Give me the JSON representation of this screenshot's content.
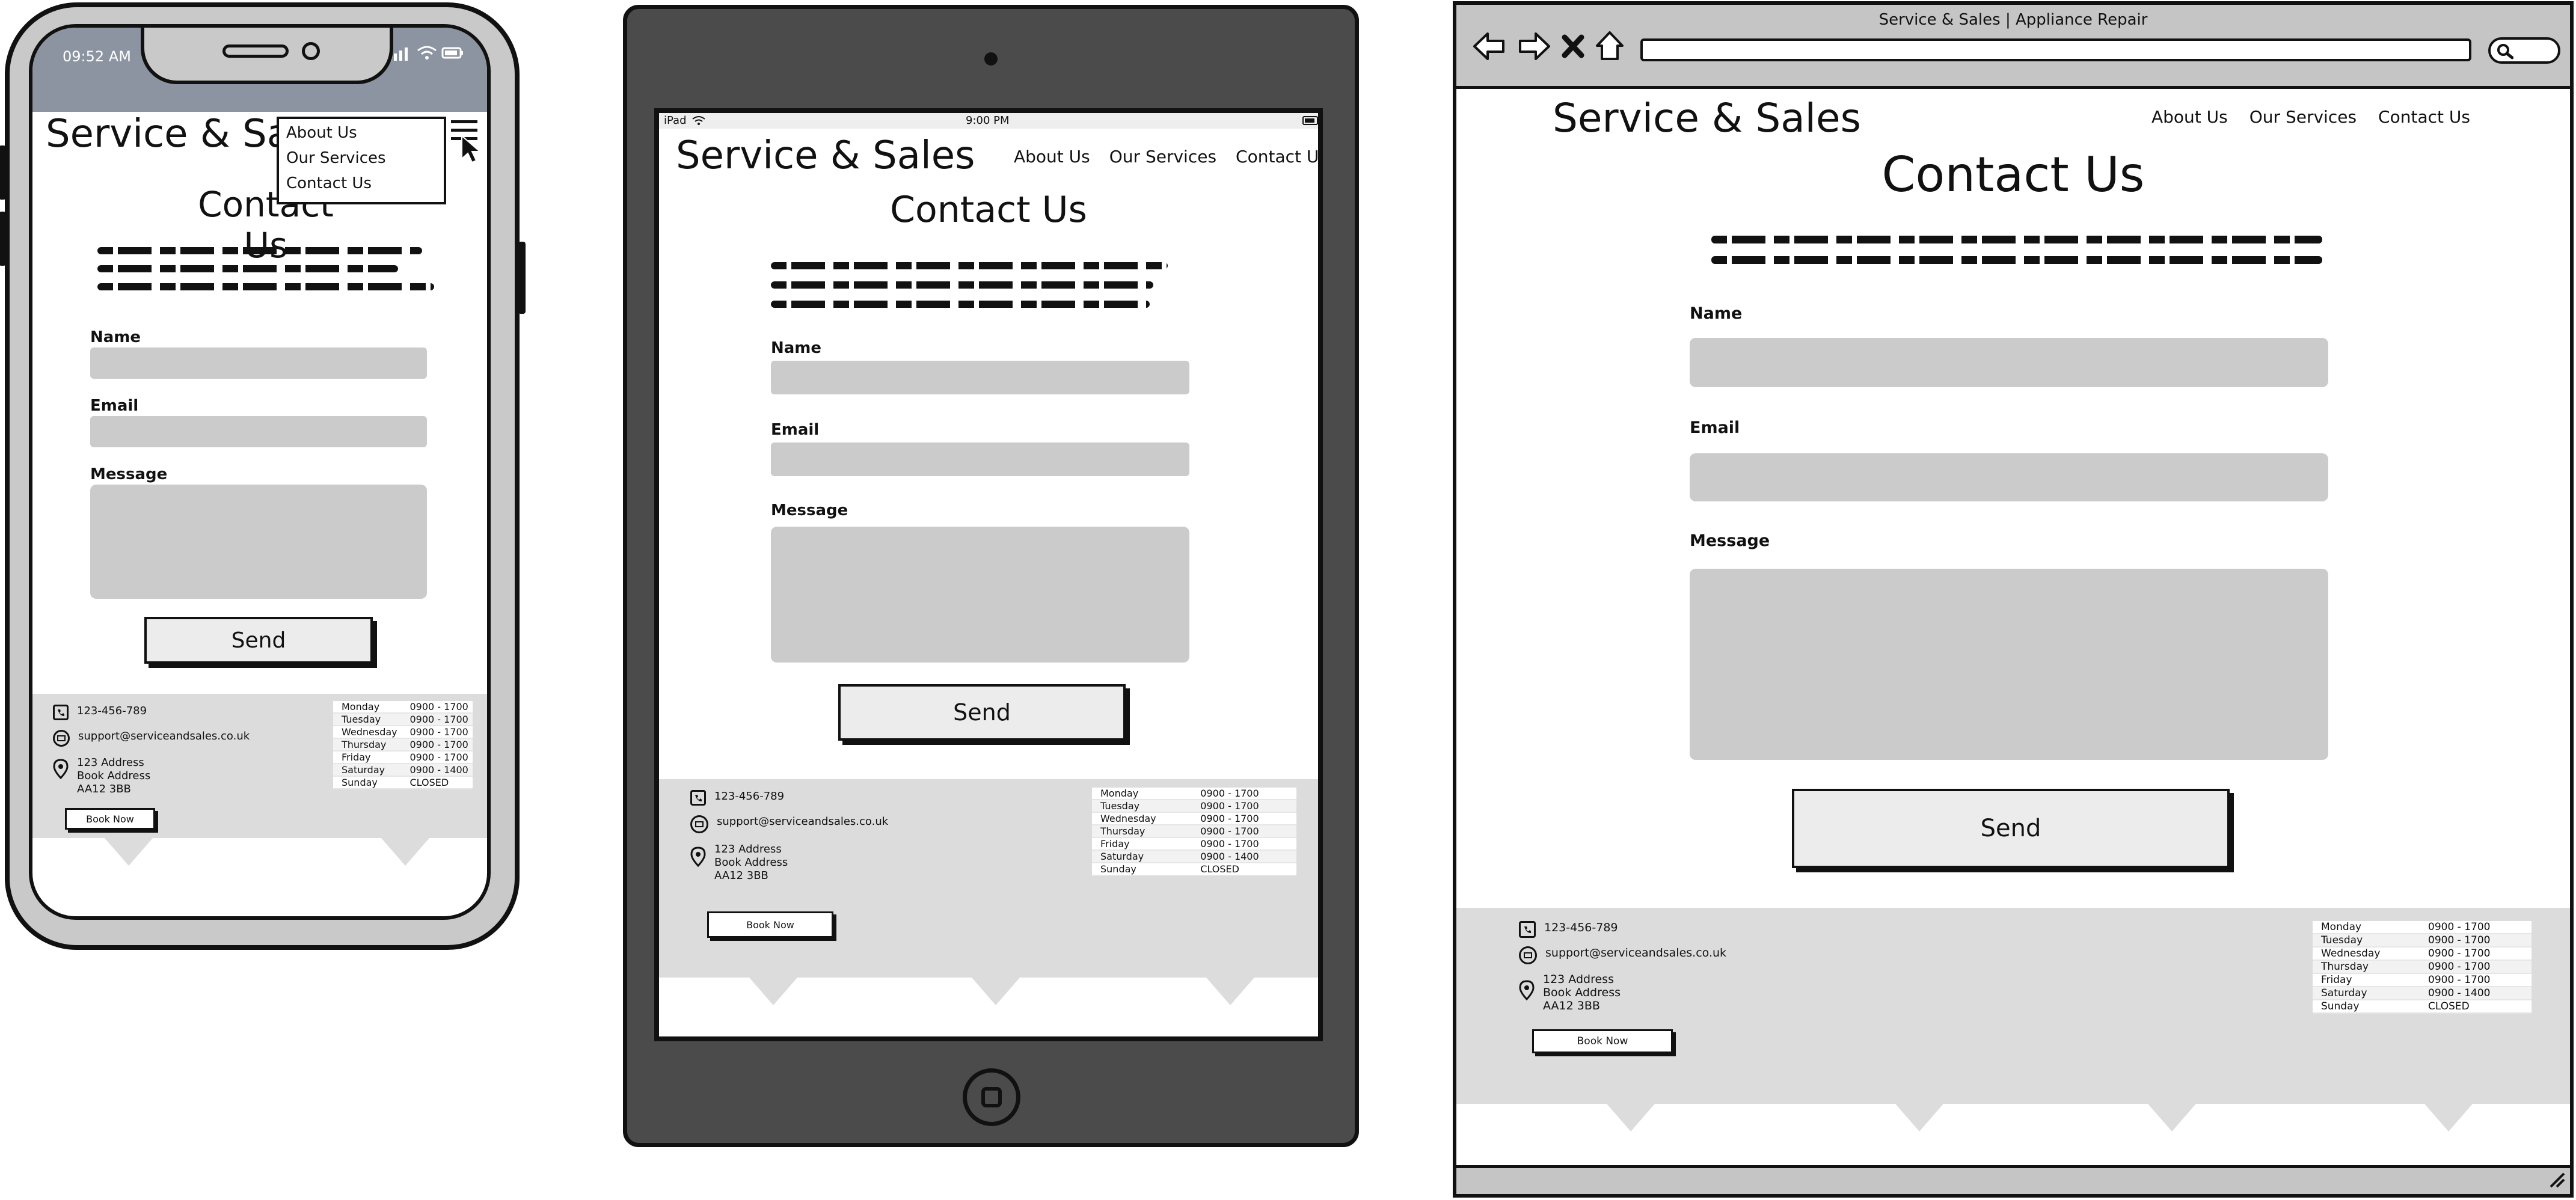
{
  "brand": "Service & Sales",
  "nav": {
    "about": "About Us",
    "services": "Our Services",
    "contact": "Contact Us"
  },
  "page_title": "Contact Us",
  "form": {
    "name_label": "Name",
    "email_label": "Email",
    "message_label": "Message",
    "send_label": "Send"
  },
  "footer": {
    "phone": "123-456-789",
    "email": "support@serviceandsales.co.uk",
    "address": [
      "123 Address",
      "Book Address",
      "AA12 3BB"
    ],
    "book_label": "Book Now",
    "hours": [
      {
        "day": "Monday",
        "time": "0900 - 1700"
      },
      {
        "day": "Tuesday",
        "time": "0900 - 1700"
      },
      {
        "day": "Wednesday",
        "time": "0900 - 1700"
      },
      {
        "day": "Thursday",
        "time": "0900 - 1700"
      },
      {
        "day": "Friday",
        "time": "0900 - 1700"
      },
      {
        "day": "Saturday",
        "time": "0900 - 1400"
      },
      {
        "day": "Sunday",
        "time": "CLOSED"
      }
    ]
  },
  "phone": {
    "status_time": "09:52 AM"
  },
  "tablet": {
    "status_left": "iPad",
    "status_time": "9:00 PM"
  },
  "browser": {
    "title": "Service & Sales | Appliance Repair",
    "url": ""
  },
  "icons": {
    "back": "back-arrow-icon",
    "forward": "forward-arrow-icon",
    "stop": "close-icon",
    "home": "home-icon",
    "search": "search-icon",
    "menu": "hamburger-menu-icon",
    "cursor": "mouse-pointer-icon",
    "phone": "phone-icon",
    "mail": "mail-icon",
    "location": "map-pin-icon",
    "wifi": "wifi-icon",
    "battery": "battery-icon",
    "signal": "signal-icon",
    "home_button": "home-button-icon"
  },
  "colors": {
    "wire_gray": "#cbcbcb",
    "footer_gray": "#dcdcdc",
    "phone_status": "#8c93a1",
    "tablet_body": "#4b4b4b",
    "outline": "#111111"
  }
}
